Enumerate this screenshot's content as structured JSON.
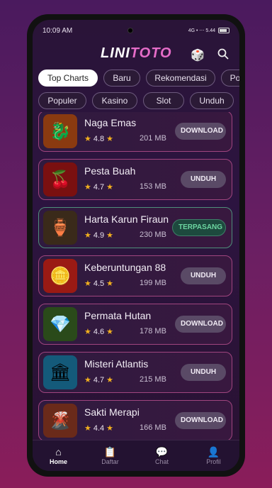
{
  "status": {
    "time": "10:09 AM",
    "right": "4G ⋮ 5.44 KB/S 📶 🔋"
  },
  "header": {
    "logo_left": "LINI",
    "logo_right": "TOTO"
  },
  "tabs_row1": [
    "Top Charts",
    "Baru",
    "Rekomendasi",
    "Po"
  ],
  "tabs_row2": [
    "Populer",
    "Kasino",
    "Slot",
    "Unduh"
  ],
  "apps": [
    {
      "title": "Naga Emas",
      "rating": "4.8",
      "size": "201 MB",
      "button": "DOWNLOAD",
      "icon": "🐉",
      "bg": "#8a3a10"
    },
    {
      "title": "Pesta Buah",
      "rating": "4.7",
      "size": "153 MB",
      "button": "UNDUH",
      "icon": "🍒",
      "bg": "#7a1010"
    },
    {
      "title": "Harta Karun Firaun",
      "rating": "4.9",
      "size": "230 MB",
      "button": "TERPASANG",
      "icon": "🏺",
      "bg": "#3a2a1a"
    },
    {
      "title": "Keberuntungan 88",
      "rating": "4.5",
      "size": "199 MB",
      "button": "UNDUH",
      "icon": "🪙",
      "bg": "#9a1a14"
    },
    {
      "title": "Permata Hutan",
      "rating": "4.6",
      "size": "178 MB",
      "button": "DOWNLOAD",
      "icon": "💎",
      "bg": "#2a4a1a"
    },
    {
      "title": "Misteri Atlantis",
      "rating": "4.7",
      "size": "215 MB",
      "button": "UNDUH",
      "icon": "🏛",
      "bg": "#145a7a"
    },
    {
      "title": "Sakti Merapi",
      "rating": "4.4",
      "size": "166 MB",
      "button": "DOWNLOAD",
      "icon": "🌋",
      "bg": "#6a2a1a"
    }
  ],
  "nav": [
    {
      "label": "Home",
      "icon": "⌂"
    },
    {
      "label": "Daftar",
      "icon": "📋"
    },
    {
      "label": "Chat",
      "icon": "💬"
    },
    {
      "label": "Profil",
      "icon": "👤"
    }
  ]
}
